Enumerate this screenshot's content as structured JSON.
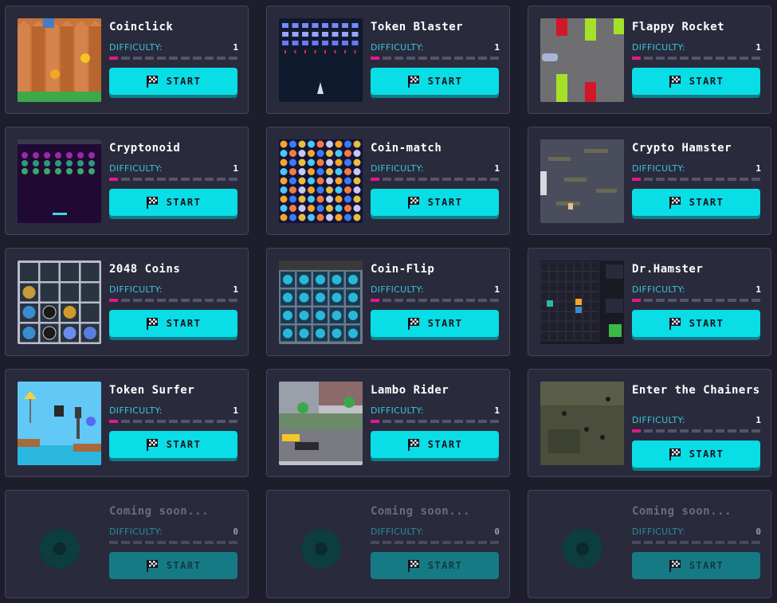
{
  "difficulty_label": "DIFFICULTY:",
  "start_label": "START",
  "games": [
    {
      "title": "Coinclick",
      "difficulty": "1",
      "thumbnail": "wooden-fence-coin"
    },
    {
      "title": "Token Blaster",
      "difficulty": "1",
      "thumbnail": "space-invaders"
    },
    {
      "title": "Flappy Rocket",
      "difficulty": "1",
      "thumbnail": "flappy-pipes"
    },
    {
      "title": "Cryptonoid",
      "difficulty": "1",
      "thumbnail": "breakout-bricks"
    },
    {
      "title": "Coin-match",
      "difficulty": "1",
      "thumbnail": "match-three-coins"
    },
    {
      "title": "Crypto Hamster",
      "difficulty": "1",
      "thumbnail": "platform-islands"
    },
    {
      "title": "2048 Coins",
      "difficulty": "1",
      "thumbnail": "tile-grid-coins"
    },
    {
      "title": "Coin-Flip",
      "difficulty": "1",
      "thumbnail": "memory-cards"
    },
    {
      "title": "Dr.Hamster",
      "difficulty": "1",
      "thumbnail": "puzzle-grid"
    },
    {
      "title": "Token Surfer",
      "difficulty": "1",
      "thumbnail": "runner-sky"
    },
    {
      "title": "Lambo Rider",
      "difficulty": "1",
      "thumbnail": "city-street"
    },
    {
      "title": "Enter the Chainers",
      "difficulty": "1",
      "thumbnail": "topdown-field"
    },
    {
      "title": "Coming soon...",
      "difficulty": "0",
      "thumbnail": "placeholder"
    },
    {
      "title": "Coming soon...",
      "difficulty": "0",
      "thumbnail": "placeholder"
    },
    {
      "title": "Coming soon...",
      "difficulty": "0",
      "thumbnail": "placeholder"
    }
  ],
  "colors": {
    "background": "#1e1d2b",
    "card": "#2a2a3d",
    "accent_cyan": "#09dde6",
    "difficulty_label": "#38c6d8",
    "difficulty_fill": "#e01a8c"
  }
}
